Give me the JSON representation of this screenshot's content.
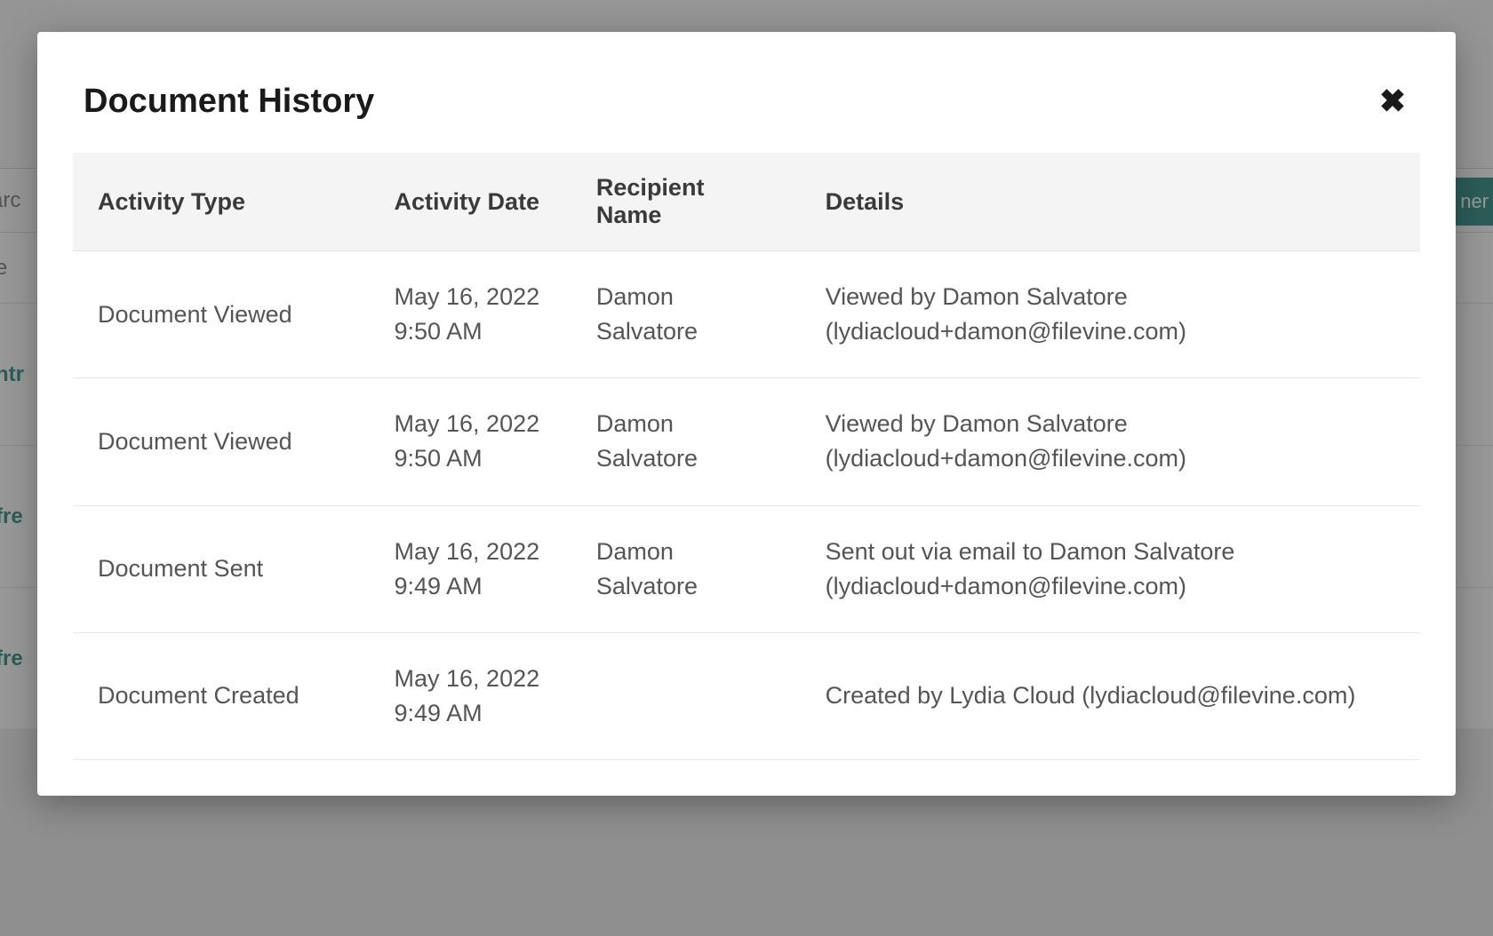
{
  "modal": {
    "title": "Document History",
    "columns": {
      "activity_type": "Activity Type",
      "activity_date": "Activity Date",
      "recipient_name": "Recipient Name",
      "details": "Details"
    },
    "rows": [
      {
        "activity_type": "Document Viewed",
        "activity_date": "May 16, 2022 9:50 AM",
        "recipient_name": "Damon Salvatore",
        "details": "Viewed by Damon Salvatore (lydiacloud+damon@filevine.com)"
      },
      {
        "activity_type": "Document Viewed",
        "activity_date": "May 16, 2022 9:50 AM",
        "recipient_name": "Damon Salvatore",
        "details": "Viewed by Damon Salvatore (lydiacloud+damon@filevine.com)"
      },
      {
        "activity_type": "Document Sent",
        "activity_date": "May 16, 2022 9:49 AM",
        "recipient_name": "Damon Salvatore",
        "details": "Sent out via email to Damon Salvatore (lydiacloud+damon@filevine.com)"
      },
      {
        "activity_type": "Document Created",
        "activity_date": "May 16, 2022 9:49 AM",
        "recipient_name": "",
        "details": "Created by Lydia Cloud (lydiacloud@filevine.com)"
      }
    ]
  },
  "background": {
    "search_fragment": "arc",
    "header_row_fragment": "e",
    "link_fragment_1": "ntr",
    "link_fragment_2": "fre",
    "link_fragment_3": "fre",
    "button_fragment": "ner"
  }
}
